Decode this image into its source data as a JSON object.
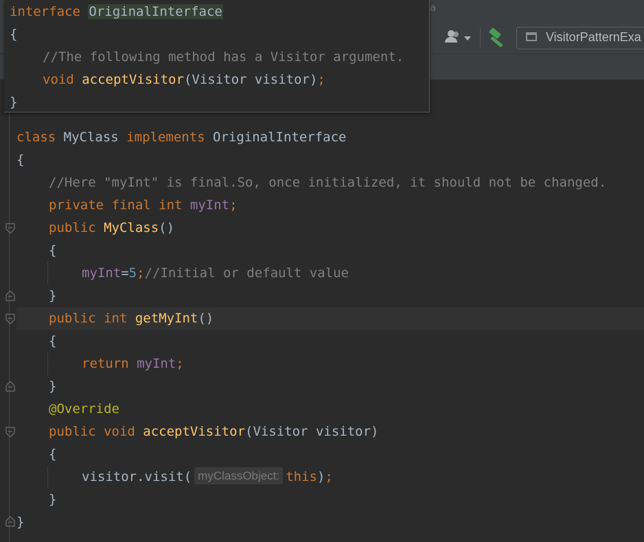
{
  "toolbar": {
    "hint_text": "a",
    "user_icon": "user-account-icon",
    "build_icon": "hammer-icon",
    "run_config_label": "VisitorPatternExa",
    "run_config_icon": "window-icon"
  },
  "popup": {
    "line1": {
      "kw": "interface",
      "name": "OriginalInterface"
    },
    "line2": "{",
    "line3": "//The following method has a Visitor argument.",
    "line4": {
      "kw": "void",
      "fn": "acceptVisitor",
      "rest": "(Visitor visitor)",
      "semi": ";"
    },
    "line5": "}"
  },
  "code": {
    "class_line": {
      "kw1": "class",
      "name": "MyClass",
      "kw2": "implements",
      "iface": "OriginalInterface"
    },
    "open_brace": "{",
    "comment1": "//Here \"myInt\" is final.So, once initialized, it should not be changed.",
    "field_line": {
      "kw": "private final int",
      "field": "myInt",
      "semi": ";"
    },
    "ctor_line": {
      "kw": "public",
      "fn": "MyClass",
      "parens": "()"
    },
    "ctor_open": "{",
    "assign_line": {
      "field": "myInt",
      "eq": "=",
      "num": "5",
      "semi": ";",
      "comment": "//Initial or default value"
    },
    "ctor_close": "}",
    "getter_line": {
      "kw": "public int",
      "fn": "getMyInt",
      "parens": "()"
    },
    "getter_open": "{",
    "return_line": {
      "kw": "return",
      "field": "myInt",
      "semi": ";"
    },
    "getter_close": "}",
    "annotation": "@Override",
    "accept_line": {
      "kw": "public void",
      "fn": "acceptVisitor",
      "rest": "(Visitor visitor)"
    },
    "accept_open": "{",
    "visit_line": {
      "pre": "visitor.visit(",
      "hint": "myClassObject:",
      "kw": "this",
      "post": ")",
      "semi": ";"
    },
    "accept_close": "}",
    "class_close": "}"
  }
}
